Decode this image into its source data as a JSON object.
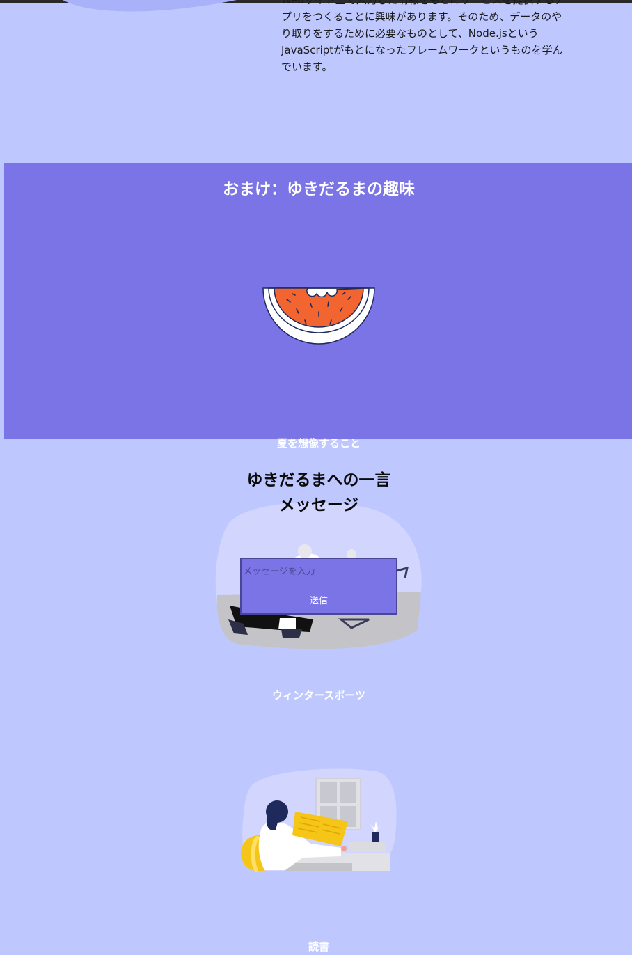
{
  "intro": {
    "text": "Webサイト上で入力した情報をもとにサービスを提供するアプリをつくることに興味があります。そのため、データのやり取りをするために必要なものとして、Node.jsというJavaScriptがもとになったフレームワークというものを学んでいます。"
  },
  "hobby": {
    "title": "おまけ：ゆきだるまの趣味",
    "items": [
      {
        "caption": "夏を想像すること",
        "icon": "watermelon-icon"
      },
      {
        "caption": "ウィンタースポーツ",
        "icon": "ice-skating-illustration"
      },
      {
        "caption": "読書",
        "icon": "reading-illustration"
      }
    ]
  },
  "message": {
    "title_line1": "ゆきだるまへの一言",
    "title_line2": "メッセージ",
    "input_placeholder": "メッセージを入力",
    "input_value": "",
    "send_label": "送信"
  },
  "colors": {
    "page_background": "#bec8ff",
    "section_accent": "#7b74e6",
    "watermelon_flesh": "#f26530",
    "dark_navy": "#1e2a5c"
  }
}
